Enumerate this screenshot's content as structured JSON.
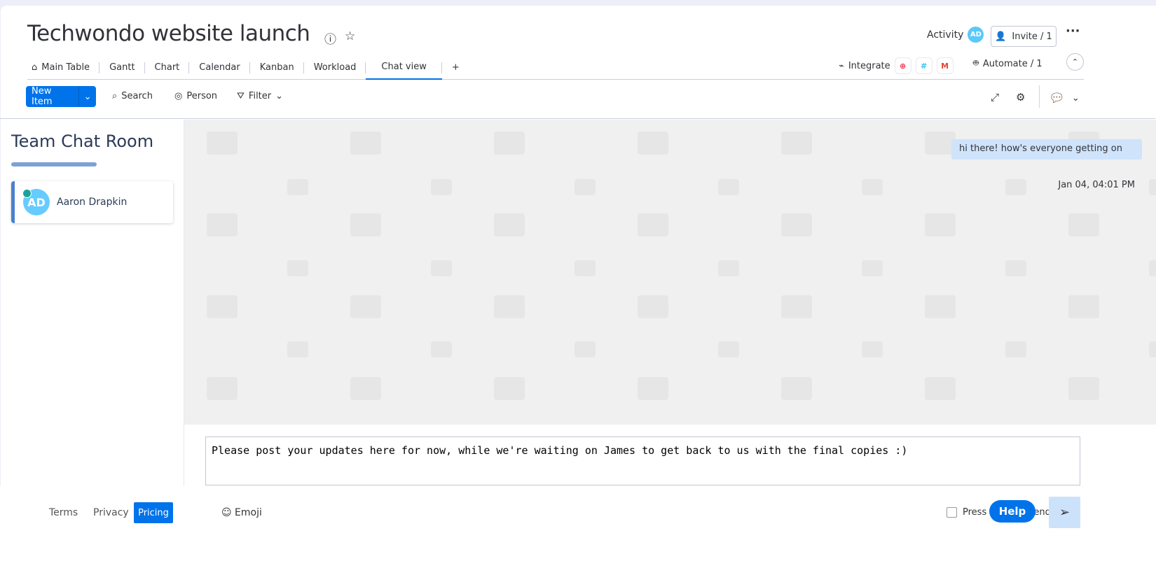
{
  "header": {
    "title": "Techwondo website launch",
    "activity_label": "Activity",
    "avatar_initials": "AD",
    "invite_label": "Invite / 1"
  },
  "tabs": [
    {
      "label": "Main Table"
    },
    {
      "label": "Gantt"
    },
    {
      "label": "Chart"
    },
    {
      "label": "Calendar"
    },
    {
      "label": "Kanban"
    },
    {
      "label": "Workload"
    },
    {
      "label": "Chat view",
      "active": true
    },
    {
      "label": "+"
    }
  ],
  "integrations": {
    "integrate_label": "Integrate",
    "automate_label": "Automate / 1",
    "apps": [
      "twilio",
      "slack",
      "gmail"
    ]
  },
  "toolbar": {
    "new_item_label": "New Item",
    "search_label": "Search",
    "person_label": "Person",
    "filter_label": "Filter"
  },
  "sidebar": {
    "title": "Team Chat Room",
    "members": [
      {
        "initials": "AD",
        "name": "Aaron Drapkin",
        "online": true
      }
    ]
  },
  "chat": {
    "messages": [
      {
        "text": "hi there! how's everyone getting on",
        "timestamp": "Jan 04, 04:01 PM"
      }
    ],
    "input_value": "Please post your updates here for now, while we're waiting on James to get back to us with the final copies :)"
  },
  "footer": {
    "terms": "Terms",
    "privacy": "Privacy",
    "pricing": "Pricing",
    "emoji": "Emoji",
    "press_enter": "Press Enter to send",
    "help": "Help"
  },
  "colors": {
    "accent": "#0073ea",
    "bubble": "#cfe3fb",
    "online": "#1aa39a"
  }
}
